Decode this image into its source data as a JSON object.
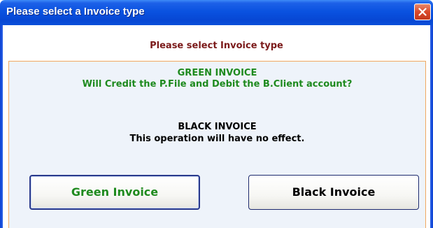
{
  "window": {
    "title": "Please select a Invoice type",
    "close_icon": "close-icon"
  },
  "dialog": {
    "header": "Please select Invoice type",
    "green": {
      "title": "GREEN INVOICE",
      "description": "Will Credit the P.File and Debit the B.Client account?"
    },
    "black": {
      "title": "BLACK INVOICE",
      "description": "This operation will have no effect."
    },
    "buttons": {
      "green_label": "Green Invoice",
      "black_label": "Black Invoice"
    }
  },
  "colors": {
    "titlebar": "#0a52e0",
    "header_text": "#7b1a1a",
    "green_text": "#1e8a1e",
    "panel_border": "#f0a860",
    "panel_background": "#eef3fa"
  }
}
